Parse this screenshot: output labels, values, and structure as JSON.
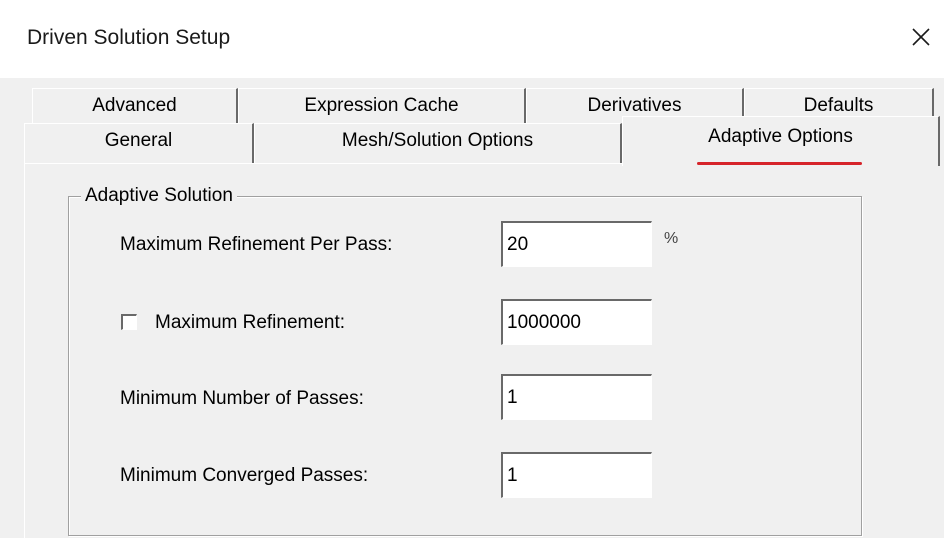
{
  "dialog": {
    "title": "Driven Solution Setup",
    "close_icon": "close-icon"
  },
  "tabs": {
    "row1": [
      "Advanced",
      "Expression Cache",
      "Derivatives",
      "Defaults"
    ],
    "row2": [
      "General",
      "Mesh/Solution Options",
      "Adaptive Options"
    ],
    "active": "Adaptive Options"
  },
  "adaptive_solution": {
    "group_title": "Adaptive Solution",
    "max_refinement_per_pass": {
      "label": "Maximum Refinement Per Pass:",
      "value": "20",
      "unit": "%"
    },
    "max_refinement": {
      "label": "Maximum Refinement:",
      "checked": false,
      "value": "1000000"
    },
    "min_passes": {
      "label": "Minimum Number of Passes:",
      "value": "1"
    },
    "min_converged_passes": {
      "label": "Minimum Converged Passes:",
      "value": "1"
    }
  },
  "colors": {
    "active_tab_underline": "#d6242a",
    "face": "#f0f0f0",
    "shadow": "#696969"
  }
}
